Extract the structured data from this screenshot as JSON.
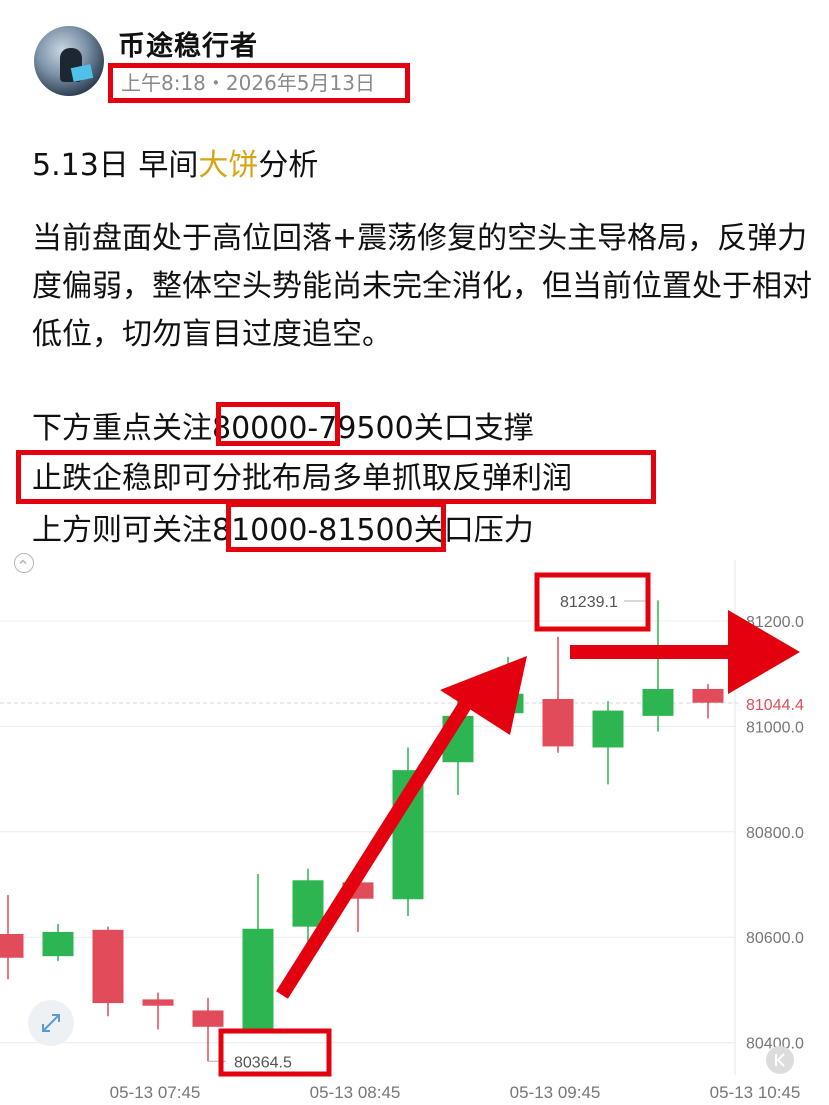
{
  "post": {
    "username": "币途稳行者",
    "timestamp": "上午8:18・2026年5月13日",
    "title_prefix": "5.13日 早间",
    "title_highlight": "大饼",
    "title_suffix": "分析",
    "paragraph": "当前盘面处于高位回落+震荡修复的空头主导格局，反弹力度偏弱，整体空头势能尚未完全消化，但当前位置处于相对低位，切勿盲目过度追空。",
    "support_line": "下方重点关注80000-79500关口支撑",
    "action_line": "止跌企稳即可分批布局多单抓取反弹利润",
    "resistance_line": "上方则可关注81000-81500关口压力"
  },
  "colors": {
    "up": "#2db552",
    "down": "#e14b5a",
    "annotation": "#e3000f",
    "highlight": "#d8a417"
  },
  "icons": {
    "collapse": "chevron-up-circle-icon",
    "expand": "expand-arrows-icon",
    "scroll_end": "double-chevron-left-icon"
  },
  "chart_data": {
    "type": "candlestick",
    "y_ticks": [
      "80400.0",
      "80600.0",
      "80800.0",
      "81000.0",
      "81200.0"
    ],
    "ylim": [
      80330,
      81340
    ],
    "x_ticks": [
      "05-13 07:45",
      "05-13 08:45",
      "05-13 09:45",
      "05-13 10:45"
    ],
    "current_price": "81044.4",
    "current_price_value": 81044.4,
    "low_label": "80364.5",
    "high_label": "81239.1",
    "candles": [
      {
        "o": 80606,
        "c": 80561,
        "h": 80680,
        "l": 80520
      },
      {
        "o": 80564,
        "c": 80610,
        "h": 80625,
        "l": 80555
      },
      {
        "o": 80614,
        "c": 80475,
        "h": 80620,
        "l": 80450
      },
      {
        "o": 80482,
        "c": 80470,
        "h": 80495,
        "l": 80425
      },
      {
        "o": 80461,
        "c": 80430,
        "h": 80485,
        "l": 80364.5
      },
      {
        "o": 80426,
        "c": 80616,
        "h": 80720,
        "l": 80420
      },
      {
        "o": 80620,
        "c": 80708,
        "h": 80730,
        "l": 80590
      },
      {
        "o": 80704,
        "c": 80673,
        "h": 80728,
        "l": 80610
      },
      {
        "o": 80672,
        "c": 80917,
        "h": 80960,
        "l": 80640
      },
      {
        "o": 80932,
        "c": 81020,
        "h": 81070,
        "l": 80870
      },
      {
        "o": 81025,
        "c": 81062,
        "h": 81132,
        "l": 80995
      },
      {
        "o": 81052,
        "c": 80962,
        "h": 81170,
        "l": 80950
      },
      {
        "o": 80960,
        "c": 81030,
        "h": 81048,
        "l": 80890
      },
      {
        "o": 81020,
        "c": 81071,
        "h": 81239.1,
        "l": 80990
      },
      {
        "o": 81071,
        "c": 81045,
        "h": 81080,
        "l": 81015
      }
    ]
  }
}
